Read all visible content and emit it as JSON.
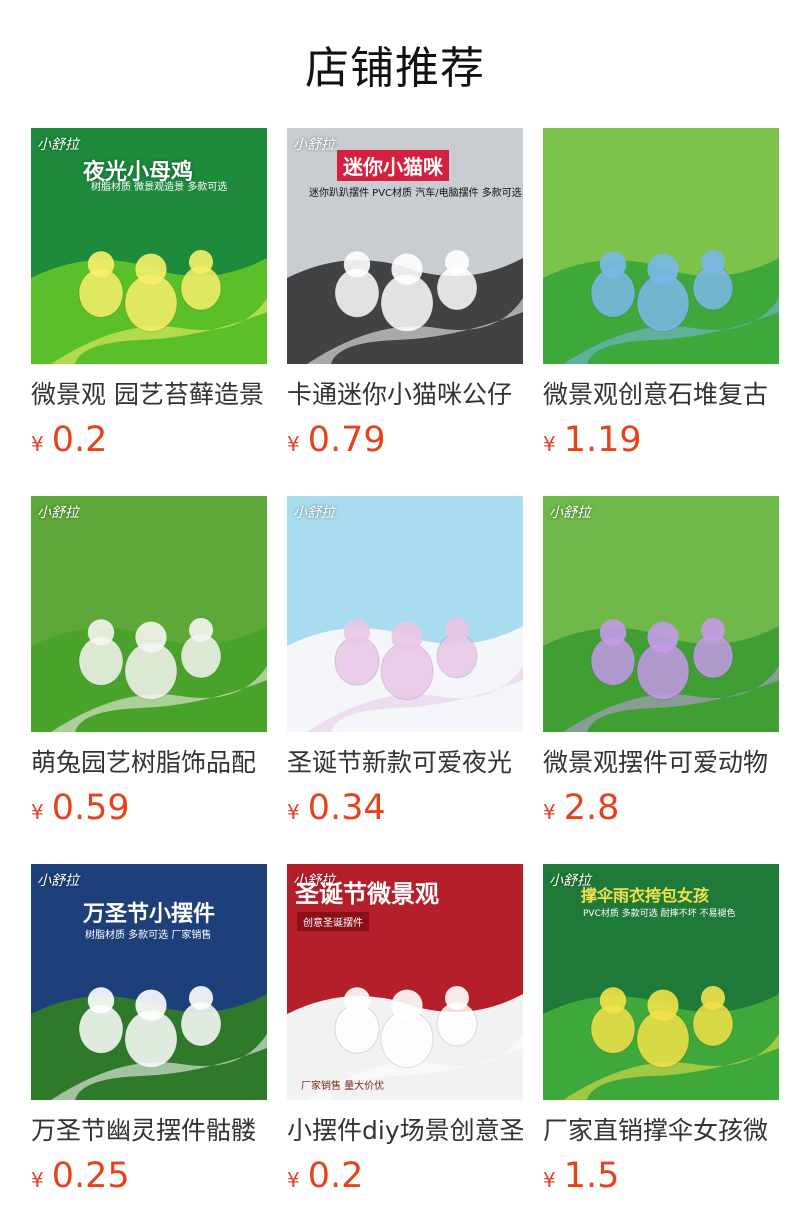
{
  "header": {
    "title": "店铺推荐"
  },
  "currency_symbol": "¥",
  "products": [
    {
      "title": "微景观 园艺苔藓造景",
      "price": "0.2",
      "brand": "小舒拉",
      "banner": "夜光小母鸡",
      "sub": "树脂材质 微景观造景 多款可选",
      "colors": {
        "sky": "#1d8a3c",
        "ground": "#5bbf2a",
        "accent": "#f7f06a"
      }
    },
    {
      "title": "卡通迷你小猫咪公仔",
      "price": "0.79",
      "brand": "小舒拉",
      "banner": "迷你小猫咪",
      "sub": "迷你趴趴摆件 PVC材质 汽车/电脑摆件 多款可选",
      "colors": {
        "sky": "#c9ccd1",
        "ground": "#404244",
        "accent": "#ffffff"
      }
    },
    {
      "title": "微景观创意石堆复古",
      "price": "1.19",
      "colors": {
        "sky": "#7dc24a",
        "ground": "#3fa83a",
        "accent": "#7ab8e8"
      }
    },
    {
      "title": "萌兔园艺树脂饰品配",
      "price": "0.59",
      "brand": "小舒拉",
      "colors": {
        "sky": "#5ea83a",
        "ground": "#49a32b",
        "accent": "#f5f5f0"
      }
    },
    {
      "title": "圣诞节新款可爱夜光",
      "price": "0.34",
      "brand": "小舒拉",
      "colors": {
        "sky": "#a9dcef",
        "ground": "#f4f6fa",
        "accent": "#e9c7e6"
      }
    },
    {
      "title": "微景观摆件可爱动物",
      "price": "2.8",
      "brand": "小舒拉",
      "colors": {
        "sky": "#6fb84a",
        "ground": "#3f9f33",
        "accent": "#c49ae8"
      }
    },
    {
      "title": "万圣节幽灵摆件骷髅",
      "price": "0.25",
      "brand": "小舒拉",
      "banner": "万圣节小摆件",
      "sub": "树脂材质 多款可选 厂家销售",
      "colors": {
        "sky": "#1d3f7a",
        "ground": "#2f7a2a",
        "accent": "#ffffff"
      }
    },
    {
      "title": "小摆件diy场景创意圣",
      "price": "0.2",
      "brand": "小舒拉",
      "banner": "圣诞节微景观",
      "sub": "创意圣诞摆件",
      "footer": "厂家销售 量大价优",
      "colors": {
        "sky": "#b51f2a",
        "ground": "#f2f2f2",
        "accent": "#ffffff"
      }
    },
    {
      "title": "厂家直销撑伞女孩微",
      "price": "1.5",
      "brand": "小舒拉",
      "banner": "撑伞雨衣挎包女孩",
      "sub": "PVC材质 多款可选 耐摔不坏 不易褪色",
      "colors": {
        "sky": "#1f7a3a",
        "ground": "#3fa83a",
        "accent": "#f2e24a"
      }
    }
  ]
}
